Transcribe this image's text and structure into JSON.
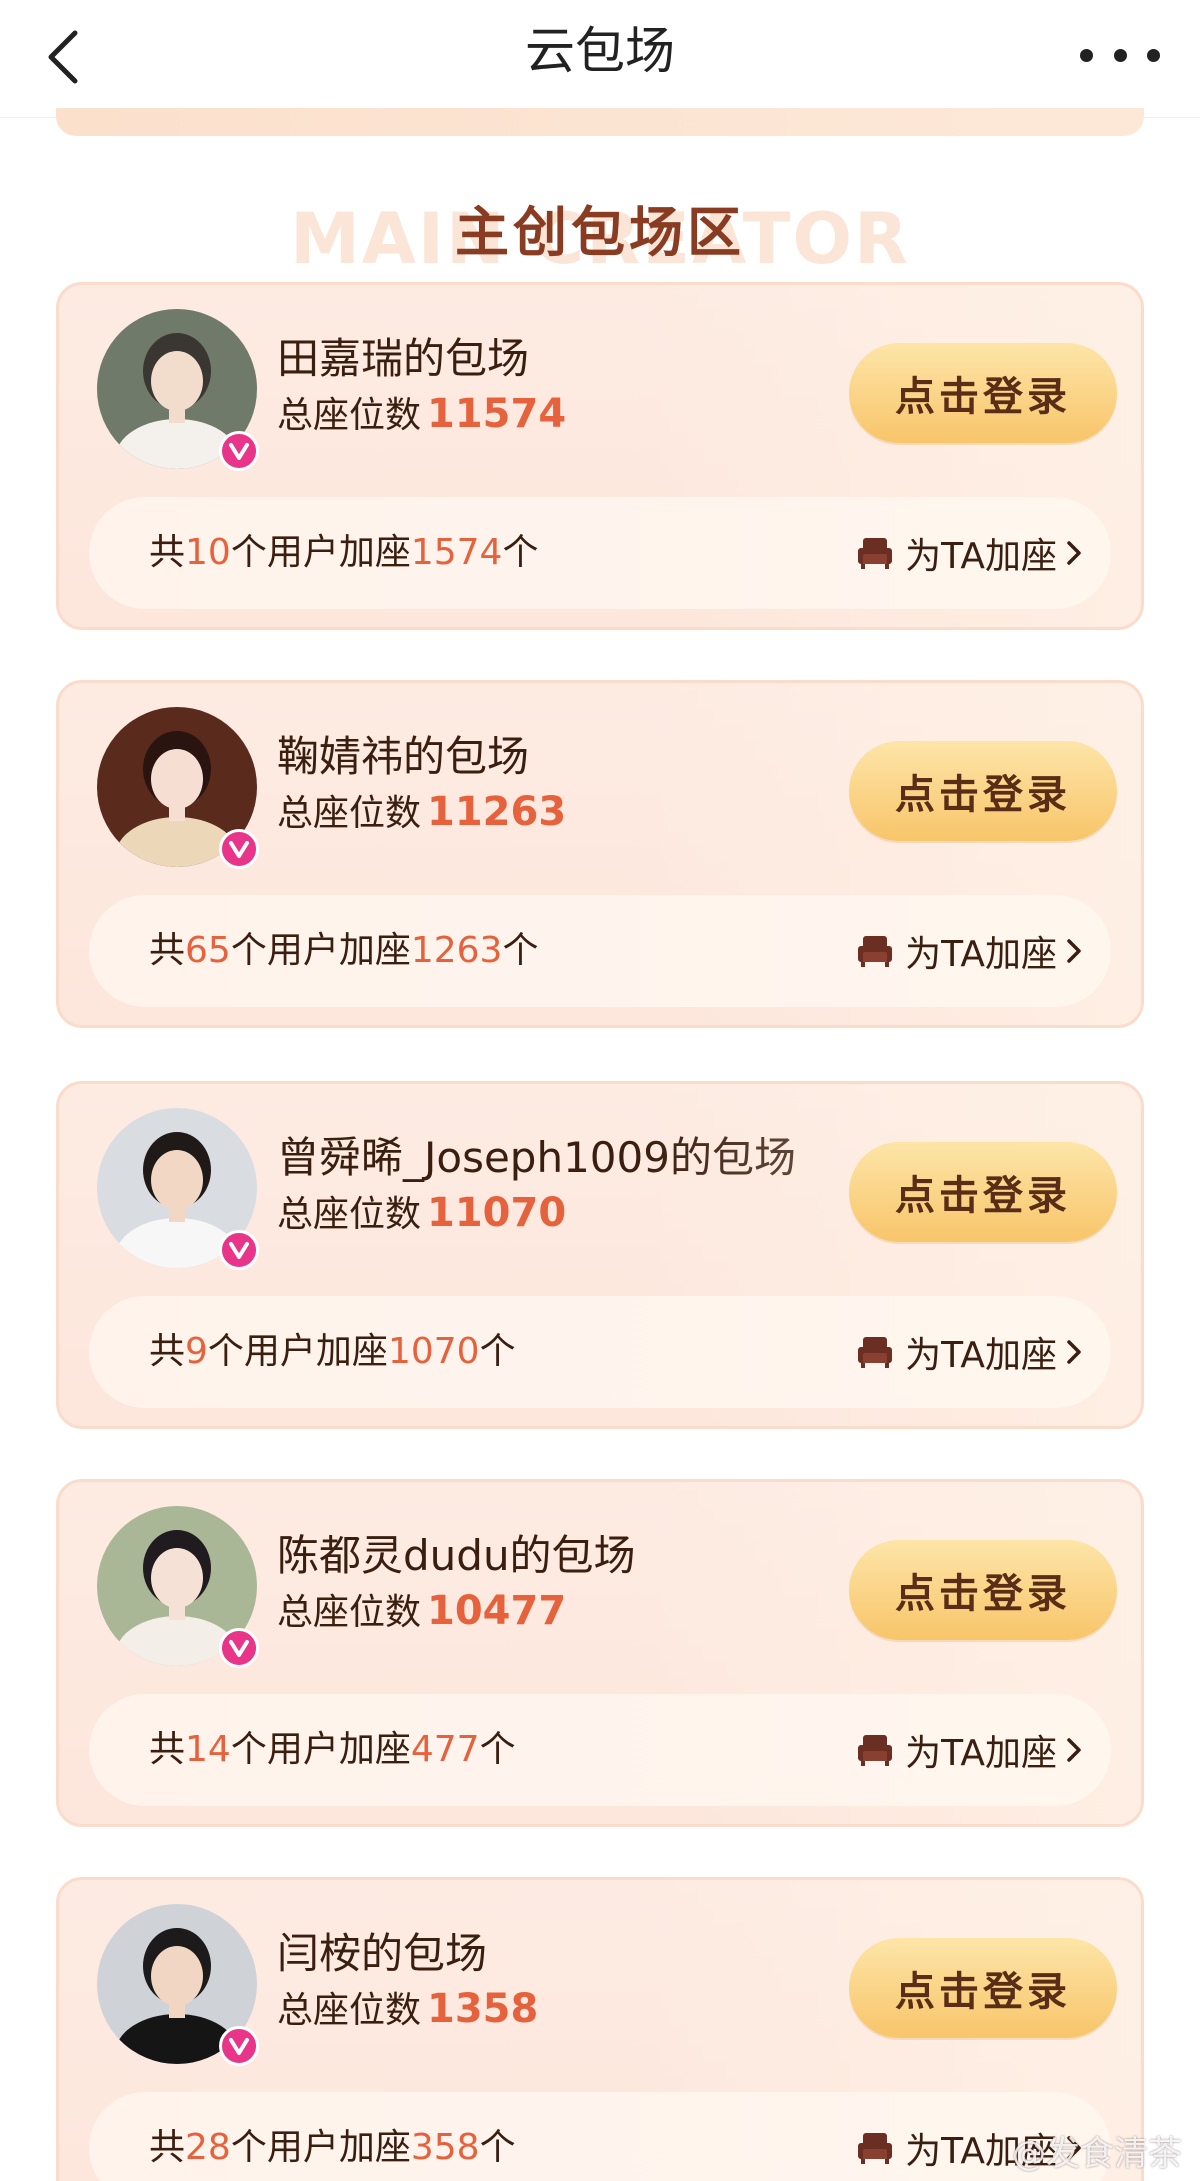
{
  "nav": {
    "title": "云包场"
  },
  "section": {
    "title": "主创包场区",
    "bg_text": "MAIN CREATOR"
  },
  "cards": [
    {
      "name": "田嘉瑞的包场",
      "seats_label": "总座位数",
      "seats": "11574",
      "bar_prefix": "共",
      "users": "10",
      "bar_mid": "个用户加座",
      "added": "1574",
      "bar_suffix": "个",
      "login_label": "点击登录",
      "add_seat_label": "为TA加座"
    },
    {
      "name": "鞠婧祎的包场",
      "seats_label": "总座位数",
      "seats": "11263",
      "bar_prefix": "共",
      "users": "65",
      "bar_mid": "个用户加座",
      "added": "1263",
      "bar_suffix": "个",
      "login_label": "点击登录",
      "add_seat_label": "为TA加座"
    },
    {
      "name": "曾舜晞_Joseph1009的包场",
      "seats_label": "总座位数",
      "seats": "11070",
      "bar_prefix": "共",
      "users": "9",
      "bar_mid": "个用户加座",
      "added": "1070",
      "bar_suffix": "个",
      "login_label": "点击登录",
      "add_seat_label": "为TA加座"
    },
    {
      "name": "陈都灵dudu的包场",
      "seats_label": "总座位数",
      "seats": "10477",
      "bar_prefix": "共",
      "users": "14",
      "bar_mid": "个用户加座",
      "added": "477",
      "bar_suffix": "个",
      "login_label": "点击登录",
      "add_seat_label": "为TA加座"
    },
    {
      "name": "闫桉的包场",
      "seats_label": "总座位数",
      "seats": "1358",
      "bar_prefix": "共",
      "users": "28",
      "bar_mid": "个用户加座",
      "added": "358",
      "bar_suffix": "个",
      "login_label": "点击登录",
      "add_seat_label": "为TA加座"
    }
  ],
  "watermark": "@发食清茶",
  "colors": {
    "accent_number": "#e5623d",
    "login_button": "#f8c56a",
    "verified_badge": "#e8358a",
    "heading": "#8a3c22"
  }
}
